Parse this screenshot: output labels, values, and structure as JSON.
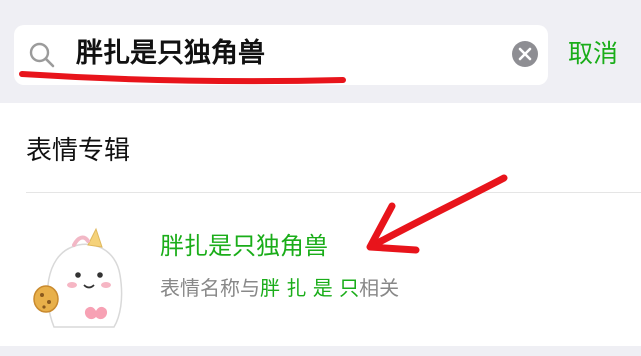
{
  "search": {
    "query": "胖扎是只独角兽",
    "cancel_label": "取消"
  },
  "section": {
    "title": "表情专辑"
  },
  "result": {
    "title": "胖扎是只独角兽",
    "desc_prefix": "表情名称与",
    "desc_highlight": "胖 扎 是 只",
    "desc_suffix": "相关"
  },
  "colors": {
    "accent": "#1aad19",
    "annotation": "#e8141b",
    "header_bg": "#efeff4"
  },
  "icons": [
    "search-icon",
    "clear-icon",
    "unicorn-sticker-thumbnail"
  ]
}
